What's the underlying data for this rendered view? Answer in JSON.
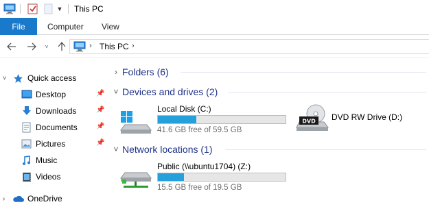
{
  "window": {
    "title": "This PC"
  },
  "ribbon": {
    "tabs": [
      {
        "label": "File"
      },
      {
        "label": "Computer"
      },
      {
        "label": "View"
      }
    ]
  },
  "address": {
    "path": "This PC"
  },
  "sidebar": {
    "quick_access": "Quick access",
    "items": [
      {
        "label": "Desktop",
        "icon": "desktop-icon",
        "pinned": true
      },
      {
        "label": "Downloads",
        "icon": "downloads-icon",
        "pinned": true
      },
      {
        "label": "Documents",
        "icon": "documents-icon",
        "pinned": true
      },
      {
        "label": "Pictures",
        "icon": "pictures-icon",
        "pinned": true
      },
      {
        "label": "Music",
        "icon": "music-icon",
        "pinned": false
      },
      {
        "label": "Videos",
        "icon": "videos-icon",
        "pinned": false
      }
    ],
    "onedrive": "OneDrive"
  },
  "content": {
    "folders_header": "Folders (6)",
    "devices_header": "Devices and drives (2)",
    "network_header": "Network locations (1)",
    "drives": [
      {
        "name": "Local Disk (C:)",
        "free_text": "41.6 GB free of 59.5 GB",
        "used_fraction": 0.3
      },
      {
        "name": "DVD RW Drive (D:)"
      }
    ],
    "network": [
      {
        "name": "Public (\\\\ubuntu1704) (Z:)",
        "free_text": "15.5 GB free of 19.5 GB",
        "used_fraction": 0.205
      }
    ]
  },
  "colors": {
    "accent": "#1979ca",
    "header_text": "#1e3287",
    "progress": "#26a0da"
  }
}
